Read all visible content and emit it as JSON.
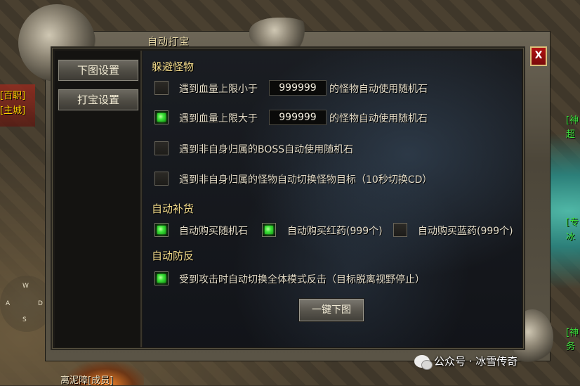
{
  "window": {
    "title": "自动打宝",
    "close_label": "X"
  },
  "sidebar": {
    "tabs": [
      {
        "label": "下图设置",
        "active": false
      },
      {
        "label": "打宝设置",
        "active": true
      }
    ]
  },
  "avoid_monster": {
    "heading": "躲避怪物",
    "rows": [
      {
        "checked": false,
        "prefix": "遇到血量上限小于",
        "value": "999999",
        "suffix": "的怪物自动使用随机石"
      },
      {
        "checked": true,
        "prefix": "遇到血量上限大于",
        "value": "999999",
        "suffix": "的怪物自动使用随机石"
      },
      {
        "checked": false,
        "text": "遇到非自身归属的BOSS自动使用随机石"
      },
      {
        "checked": false,
        "text": "遇到非自身归属的怪物自动切换怪物目标（10秒切换CD）"
      }
    ]
  },
  "auto_supply": {
    "heading": "自动补货",
    "items": [
      {
        "checked": true,
        "text": "自动购买随机石"
      },
      {
        "checked": true,
        "text": "自动购买红药(999个)"
      },
      {
        "checked": false,
        "text": "自动购买蓝药(999个)"
      }
    ]
  },
  "auto_counter": {
    "heading": "自动防反",
    "items": [
      {
        "checked": true,
        "text": "受到攻击时自动切换全体模式反击（目标脱离视野停止）"
      }
    ]
  },
  "action_button": "一键下图",
  "world": {
    "left_labels": [
      "[百职]",
      "[主城]"
    ],
    "right_labels": [
      "[神",
      "超",
      "[专",
      "冰",
      "[神",
      "务"
    ],
    "bottom_label": "离泥障[成员]",
    "compass": {
      "n": "W",
      "w": "A",
      "e": "D",
      "s": "S"
    }
  },
  "watermark": "公众号 · 冰雪传奇"
}
